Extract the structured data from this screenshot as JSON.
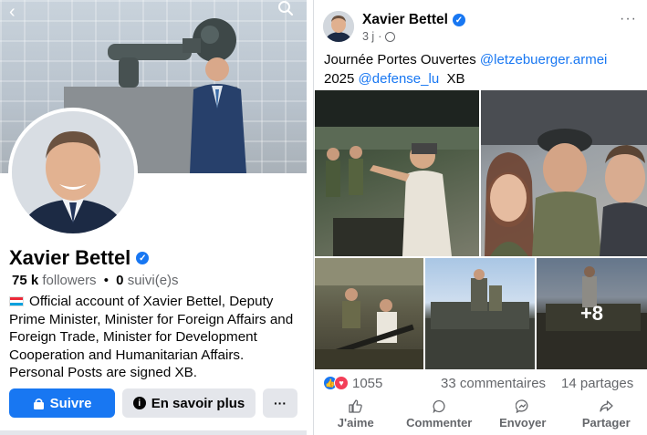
{
  "left": {
    "cover_icons": {
      "back": "chevron-left-icon",
      "search": "search-icon"
    },
    "profile": {
      "name": "Xavier Bettel",
      "followers_count": "75 k",
      "followers_label": "followers",
      "following_count": "0",
      "following_label": "suivi(e)s",
      "separator": "•",
      "bio": "Official account of Xavier Bettel, Deputy Prime Minister, Minister for Foreign Affairs and Foreign Trade, Minister for Development Cooperation and Humanitarian Affairs. Personal Posts are signed XB."
    },
    "buttons": {
      "follow": "Suivre",
      "info": "En savoir plus",
      "more": "···"
    }
  },
  "right": {
    "post": {
      "author": "Xavier Bettel",
      "time": "3 j",
      "meta_separator": "·",
      "more": "···",
      "text_part1": "Journée Portes Ouvertes ",
      "mention1": "@letzebuerger.armei",
      "text_part2": "2025 ",
      "mention2": "@defense_lu",
      "text_part3": "  XB",
      "more_photos": "+8"
    },
    "reactions": {
      "count": "1055",
      "comments": "33 commentaires",
      "shares": "14 partages"
    },
    "actions": {
      "like": "J'aime",
      "comment": "Commenter",
      "send": "Envoyer",
      "share": "Partager"
    }
  },
  "colors": {
    "accent": "#1877f2",
    "text": "#050505",
    "muted": "#65676b",
    "button_gray": "#e4e6eb",
    "love": "#f33e58"
  }
}
